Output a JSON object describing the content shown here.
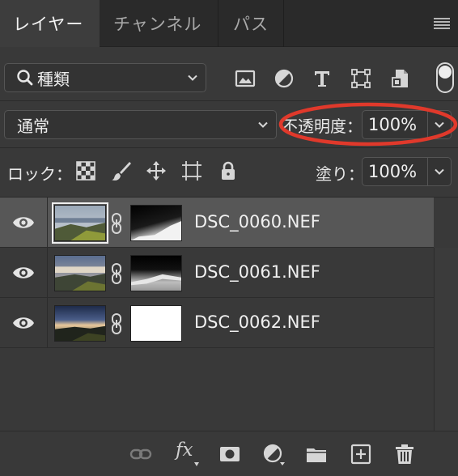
{
  "tabs": [
    {
      "label": "レイヤー"
    },
    {
      "label": "チャンネル"
    },
    {
      "label": "パス"
    }
  ],
  "filter": {
    "label": "種類",
    "icons": [
      "image-icon",
      "adjustment-icon",
      "type-icon",
      "shape-icon",
      "smart-object-icon"
    ]
  },
  "blend": {
    "mode": "通常",
    "opacity_label": "不透明度：",
    "opacity_value": "100%"
  },
  "lock": {
    "label": "ロック：",
    "icons": [
      "lock-transparent-icon",
      "lock-brush-icon",
      "lock-move-icon",
      "lock-artboard-icon",
      "lock-all-icon"
    ]
  },
  "fill": {
    "label": "塗り：",
    "value": "100%"
  },
  "layers": [
    {
      "name": "DSC_0060.NEF",
      "selected": true
    },
    {
      "name": "DSC_0061.NEF",
      "selected": false
    },
    {
      "name": "DSC_0062.NEF",
      "selected": false
    }
  ],
  "bottom_tools": {
    "fx_label": "fx"
  },
  "colors": {
    "highlight": "#e0392b",
    "panel": "#393939",
    "selected_row": "#575757"
  }
}
